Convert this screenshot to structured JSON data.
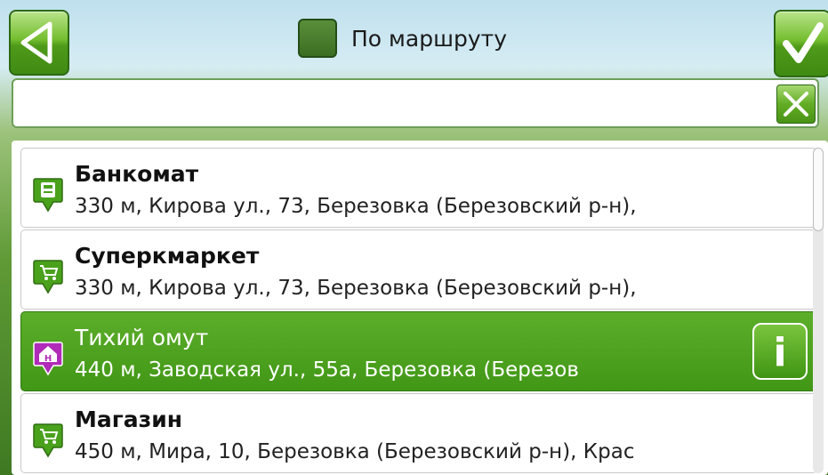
{
  "header": {
    "back_icon": "back-arrow-icon",
    "ok_icon": "checkmark-icon",
    "route_filter": {
      "label": "По маршруту",
      "checked": true
    }
  },
  "search": {
    "value": "",
    "placeholder": "",
    "clear_icon": "close-icon"
  },
  "results": [
    {
      "title": "Банкомат",
      "details": "330 м, Кирова ул., 73, Березовка (Березовский р-н),",
      "icon": "atm-pin-icon",
      "selected": false
    },
    {
      "title": "Суперкмаркет",
      "details": "330 м, Кирова ул., 73, Березовка (Березовский р-н),",
      "icon": "shopping-cart-pin-icon",
      "selected": false
    },
    {
      "title": "Тихий омут",
      "details": "440 м, Заводская ул., 55а, Березовка (Березов",
      "icon": "hotel-pin-icon",
      "selected": true
    },
    {
      "title": "Магазин",
      "details": "450 м, Мира, 10, Березовка (Березовский р-н), Крас",
      "icon": "shopping-cart-pin-icon",
      "selected": false
    }
  ],
  "info_button": {
    "label": "i",
    "icon": "info-icon"
  },
  "colors": {
    "accent": "#4aa11c",
    "selected_row": "#4a9e1e",
    "hotel_pin": "#b02bb8"
  }
}
